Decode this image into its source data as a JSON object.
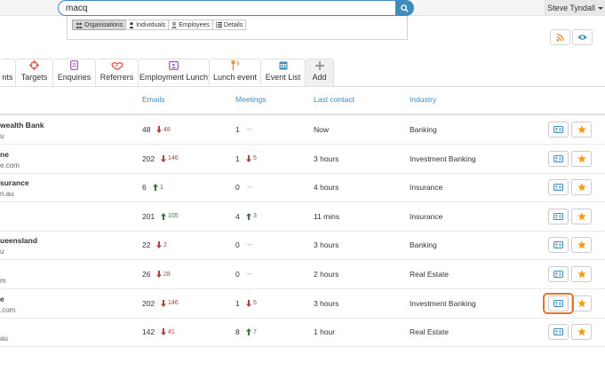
{
  "search": {
    "value": "macq",
    "placeholder": ""
  },
  "filters": [
    {
      "label": "Organisations",
      "icon": "group-icon",
      "active": true
    },
    {
      "label": "Individuals",
      "icon": "user-icon",
      "active": false
    },
    {
      "label": "Employees",
      "icon": "user-outline-icon",
      "active": false
    },
    {
      "label": "Details",
      "icon": "list-icon",
      "active": false
    }
  ],
  "user": {
    "name": "Steve Tyndall"
  },
  "header_actions": [
    {
      "name": "rss-icon",
      "color": "#e8822a"
    },
    {
      "name": "eye-icon",
      "color": "#3c8dbc"
    }
  ],
  "tabs": [
    {
      "label": "nts",
      "icon": "none"
    },
    {
      "label": "Targets",
      "icon": "crosshair-icon",
      "color": "#dd4b39"
    },
    {
      "label": "Enquiries",
      "icon": "document-icon",
      "color": "#9b59b6"
    },
    {
      "label": "Referrers",
      "icon": "handshake-icon",
      "color": "#dd4b39"
    },
    {
      "label": "Employment Lunch",
      "icon": "calendar-user-icon",
      "color": "#9b59b6"
    },
    {
      "label": "Lunch event",
      "icon": "cutlery-icon",
      "color": "#e8822a"
    },
    {
      "label": "Event List",
      "icon": "calendar-icon",
      "color": "#3c8dbc"
    },
    {
      "label": "Add",
      "icon": "plus-icon",
      "color": "#999999"
    }
  ],
  "columns": {
    "emails": "Emails",
    "meetings": "Meetings",
    "last_contact": "Last contact",
    "industry": "Industry"
  },
  "rows": [
    {
      "name": "wealth Bank",
      "site": "u",
      "emails": "48",
      "emails_delta": "48",
      "emails_dir": "down",
      "meetings": "1",
      "meetings_delta": "--",
      "meetings_dir": "none",
      "last_contact": "Now",
      "industry": "Banking"
    },
    {
      "name": "ne",
      "site": "e.com",
      "emails": "202",
      "emails_delta": "146",
      "emails_dir": "down",
      "meetings": "1",
      "meetings_delta": "5",
      "meetings_dir": "down",
      "last_contact": "3 hours",
      "industry": "Investment Banking"
    },
    {
      "name": "surance",
      "site": "n.au",
      "emails": "6",
      "emails_delta": "1",
      "emails_dir": "up",
      "meetings": "0",
      "meetings_delta": "--",
      "meetings_dir": "none",
      "last_contact": "4 hours",
      "industry": "Insurance"
    },
    {
      "name": "",
      "site": "",
      "emails": "201",
      "emails_delta": "105",
      "emails_dir": "up",
      "meetings": "4",
      "meetings_delta": "3",
      "meetings_dir": "up",
      "last_contact": "11 mins",
      "industry": "Insurance"
    },
    {
      "name": "ueensland",
      "site": "u",
      "emails": "22",
      "emails_delta": "2",
      "emails_dir": "down",
      "meetings": "0",
      "meetings_delta": "--",
      "meetings_dir": "none",
      "last_contact": "3 hours",
      "industry": "Banking"
    },
    {
      "name": "",
      "site": "m",
      "emails": "26",
      "emails_delta": "28",
      "emails_dir": "down",
      "meetings": "0",
      "meetings_delta": "--",
      "meetings_dir": "none",
      "last_contact": "2 hours",
      "industry": "Real Estate"
    },
    {
      "name": "e",
      "site": ".com",
      "emails": "202",
      "emails_delta": "146",
      "emails_dir": "down",
      "meetings": "1",
      "meetings_delta": "5",
      "meetings_dir": "down",
      "last_contact": "3 hours",
      "industry": "Investment Banking"
    },
    {
      "name": "",
      "site": "au",
      "emails": "142",
      "emails_delta": "41",
      "emails_dir": "down",
      "meetings": "8",
      "meetings_delta": "7",
      "meetings_dir": "up",
      "last_contact": "1 hour",
      "industry": "Real Estate"
    }
  ],
  "colors": {
    "accent": "#3c8dbc",
    "star": "#f39c12",
    "down": "#a94442",
    "up": "#3c763d",
    "highlight": "#e8732a"
  }
}
